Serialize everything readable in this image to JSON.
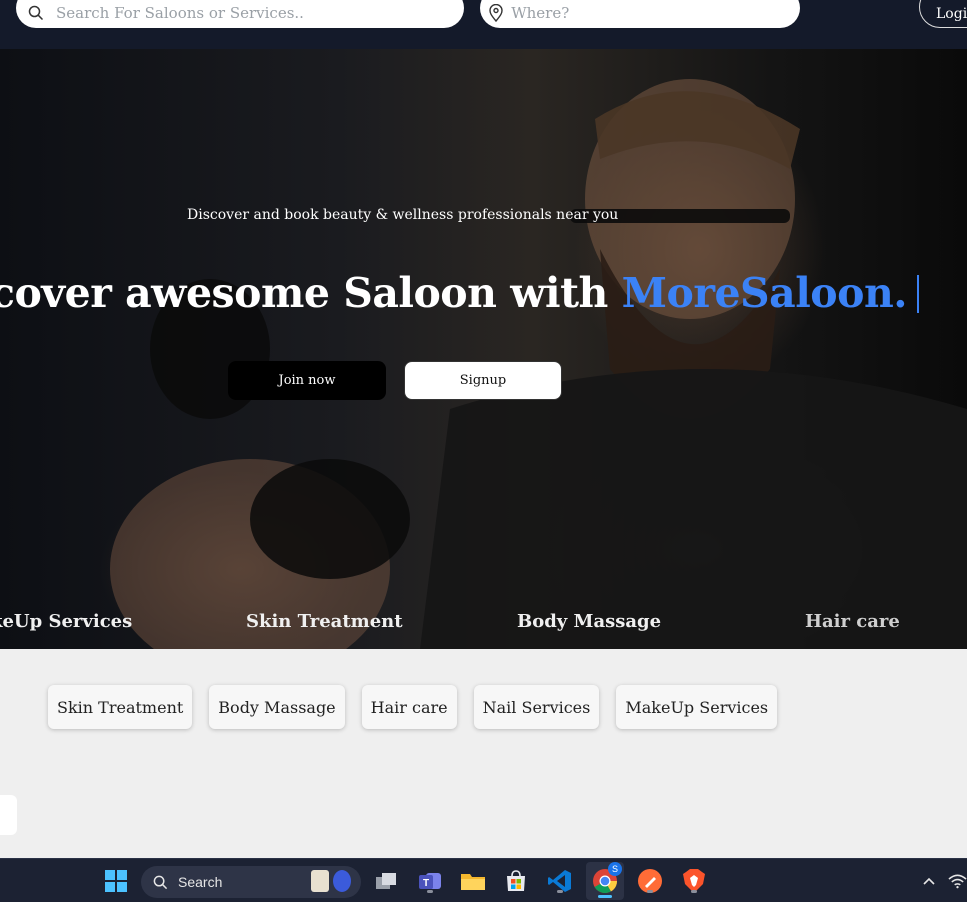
{
  "header": {
    "search_placeholder": "Search For Saloons or Services..",
    "location_placeholder": "Where?",
    "login_label": "Login"
  },
  "hero": {
    "subtitle": "Discover and book beauty & wellness professionals near you",
    "title_prefix": "cover awesome Saloon with ",
    "title_brand": "MoreSaloon.",
    "join_label": "Join now",
    "signup_label": "Signup",
    "marquee": [
      "keUp Services",
      "Skin Treatment",
      "Body Massage",
      "Hair care"
    ]
  },
  "categories": [
    "Skin Treatment",
    "Body Massage",
    "Hair care",
    "Nail Services",
    "MakeUp Services"
  ],
  "taskbar": {
    "search_label": "Search",
    "chrome_badge": "S",
    "apps": [
      "start-icon",
      "widgets-icon",
      "task-view-icon",
      "teams-icon",
      "file-explorer-icon",
      "store-icon",
      "vscode-icon",
      "chrome-icon",
      "postman-icon",
      "brave-icon",
      "chevron-up-icon",
      "wifi-icon"
    ]
  },
  "colors": {
    "brand": "#3b82f6",
    "header_bg": "#141a2a",
    "page_bg": "#efefef",
    "taskbar_bg": "#1c2233"
  }
}
